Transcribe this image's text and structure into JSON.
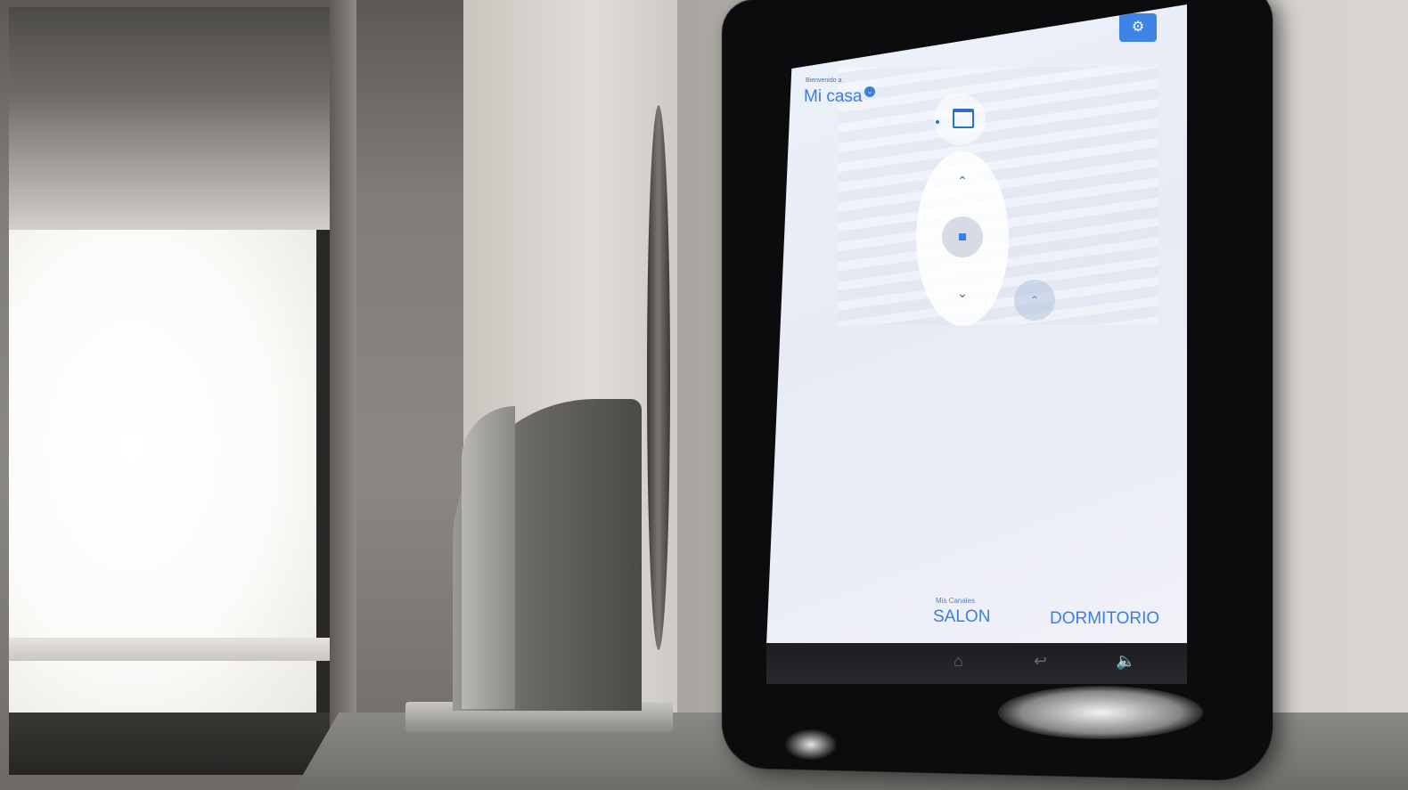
{
  "app": {
    "greeting": "Bienvenido a",
    "home_name": "Mi casa",
    "dropdown_glyph": "⌄"
  },
  "toolbar": {
    "settings_icon": "gear-icon",
    "settings_glyph": "⚙"
  },
  "blind_control": {
    "device_icon": "window-icon",
    "up_glyph": "⌃",
    "down_glyph": "⌄",
    "stop_icon": "stop-icon",
    "favorite_glyph": "⌃"
  },
  "channels": {
    "caption": "Mis Canales",
    "tabs": [
      {
        "label": "SALON"
      },
      {
        "label": "DORMITORIO"
      }
    ]
  },
  "navbar": {
    "home_glyph": "⌂",
    "back_glyph": "↩",
    "volume_glyph": "🔈"
  },
  "colors": {
    "accent": "#3b7ee0"
  }
}
